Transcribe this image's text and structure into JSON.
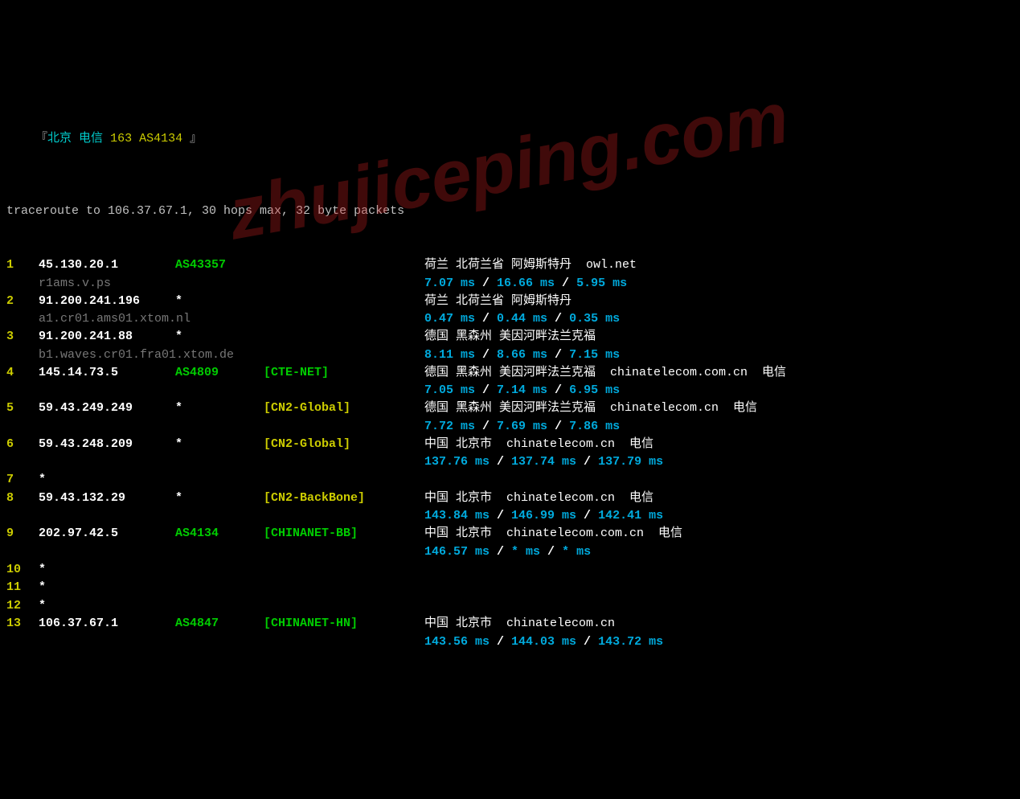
{
  "header": {
    "open_br": "『",
    "location": "北京 电信",
    "asn": "163 AS4134",
    "close_br": "』"
  },
  "trace_line": "traceroute to 106.37.67.1, 30 hops max, 32 byte packets",
  "watermark": "zhujiceping.com",
  "hops": [
    {
      "num": "1",
      "ip": "45.130.20.1",
      "asn": "AS43357",
      "tag": "",
      "tag_color": "",
      "loc": "荷兰 北荷兰省 阿姆斯特丹  owl.net",
      "reverse": "r1ams.v.ps",
      "rtt1": "7.07 ms",
      "rtt2": "16.66 ms",
      "rtt3": "5.95 ms"
    },
    {
      "num": "2",
      "ip": "91.200.241.196",
      "asn": "*",
      "tag": "",
      "tag_color": "",
      "loc": "荷兰 北荷兰省 阿姆斯特丹",
      "reverse": "a1.cr01.ams01.xtom.nl",
      "rtt1": "0.47 ms",
      "rtt2": "0.44 ms",
      "rtt3": "0.35 ms"
    },
    {
      "num": "3",
      "ip": "91.200.241.88",
      "asn": "*",
      "tag": "",
      "tag_color": "",
      "loc": "德国 黑森州 美因河畔法兰克福",
      "reverse": "b1.waves.cr01.fra01.xtom.de",
      "rtt1": "8.11 ms",
      "rtt2": "8.66 ms",
      "rtt3": "7.15 ms"
    },
    {
      "num": "4",
      "ip": "145.14.73.5",
      "asn": "AS4809",
      "tag": "[CTE-NET]",
      "tag_color": "green",
      "loc": "德国 黑森州 美因河畔法兰克福  chinatelecom.com.cn  电信",
      "reverse": "",
      "rtt1": "7.05 ms",
      "rtt2": "7.14 ms",
      "rtt3": "6.95 ms"
    },
    {
      "num": "5",
      "ip": "59.43.249.249",
      "asn": "*",
      "tag": "[CN2-Global]",
      "tag_color": "yellow",
      "loc": "德国 黑森州 美因河畔法兰克福  chinatelecom.cn  电信",
      "reverse": "",
      "rtt1": "7.72 ms",
      "rtt2": "7.69 ms",
      "rtt3": "7.86 ms"
    },
    {
      "num": "6",
      "ip": "59.43.248.209",
      "asn": "*",
      "tag": "[CN2-Global]",
      "tag_color": "yellow",
      "loc": "中国 北京市  chinatelecom.cn  电信",
      "reverse": "",
      "rtt1": "137.76 ms",
      "rtt2": "137.74 ms",
      "rtt3": "137.79 ms"
    },
    {
      "num": "7",
      "ip": "*",
      "asn": "",
      "tag": "",
      "tag_color": "",
      "loc": "",
      "reverse": "",
      "rtt1": "",
      "rtt2": "",
      "rtt3": ""
    },
    {
      "num": "8",
      "ip": "59.43.132.29",
      "asn": "*",
      "tag": "[CN2-BackBone]",
      "tag_color": "yellow",
      "loc": "中国 北京市  chinatelecom.cn  电信",
      "reverse": "",
      "rtt1": "143.84 ms",
      "rtt2": "146.99 ms",
      "rtt3": "142.41 ms"
    },
    {
      "num": "9",
      "ip": "202.97.42.5",
      "asn": "AS4134",
      "tag": "[CHINANET-BB]",
      "tag_color": "green",
      "loc": "中国 北京市  chinatelecom.com.cn  电信",
      "reverse": "",
      "rtt1": "146.57 ms",
      "rtt2": "* ms",
      "rtt3": "* ms"
    },
    {
      "num": "10",
      "ip": "*",
      "asn": "",
      "tag": "",
      "tag_color": "",
      "loc": "",
      "reverse": "",
      "rtt1": "",
      "rtt2": "",
      "rtt3": ""
    },
    {
      "num": "11",
      "ip": "*",
      "asn": "",
      "tag": "",
      "tag_color": "",
      "loc": "",
      "reverse": "",
      "rtt1": "",
      "rtt2": "",
      "rtt3": ""
    },
    {
      "num": "12",
      "ip": "*",
      "asn": "",
      "tag": "",
      "tag_color": "",
      "loc": "",
      "reverse": "",
      "rtt1": "",
      "rtt2": "",
      "rtt3": ""
    },
    {
      "num": "13",
      "ip": "106.37.67.1",
      "asn": "AS4847",
      "tag": "[CHINANET-HN]",
      "tag_color": "green",
      "loc": "中国 北京市  chinatelecom.cn",
      "reverse": "",
      "rtt1": "143.56 ms",
      "rtt2": "144.03 ms",
      "rtt3": "143.72 ms"
    }
  ]
}
